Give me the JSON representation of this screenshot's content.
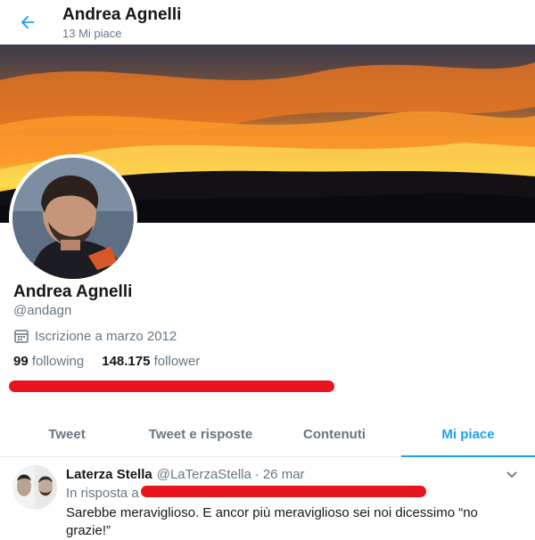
{
  "header": {
    "title": "Andrea Agnelli",
    "subtitle": "13 Mi piace",
    "back_icon": "arrow-left-icon"
  },
  "profile": {
    "name": "Andrea Agnelli",
    "handle": "@andagn",
    "joined": "Iscrizione a marzo 2012",
    "following_count": "99",
    "following_label": "following",
    "follower_count": "148.175",
    "follower_label": "follower"
  },
  "tabs": [
    {
      "label": "Tweet",
      "active": false
    },
    {
      "label": "Tweet e risposte",
      "active": false
    },
    {
      "label": "Contenuti",
      "active": false
    },
    {
      "label": "Mi piace",
      "active": true
    }
  ],
  "tweet": {
    "author": "Laterza Stella",
    "handle": "@LaTerzaStella",
    "separator": "·",
    "date": "26 mar",
    "reply_prefix": "In risposta a",
    "text": "Sarebbe meraviglioso. E ancor più meraviglioso sei noi dicessimo “no grazie!”"
  },
  "colors": {
    "accent": "#1da1f2",
    "redaction": "#e8141f",
    "muted": "#657786"
  }
}
